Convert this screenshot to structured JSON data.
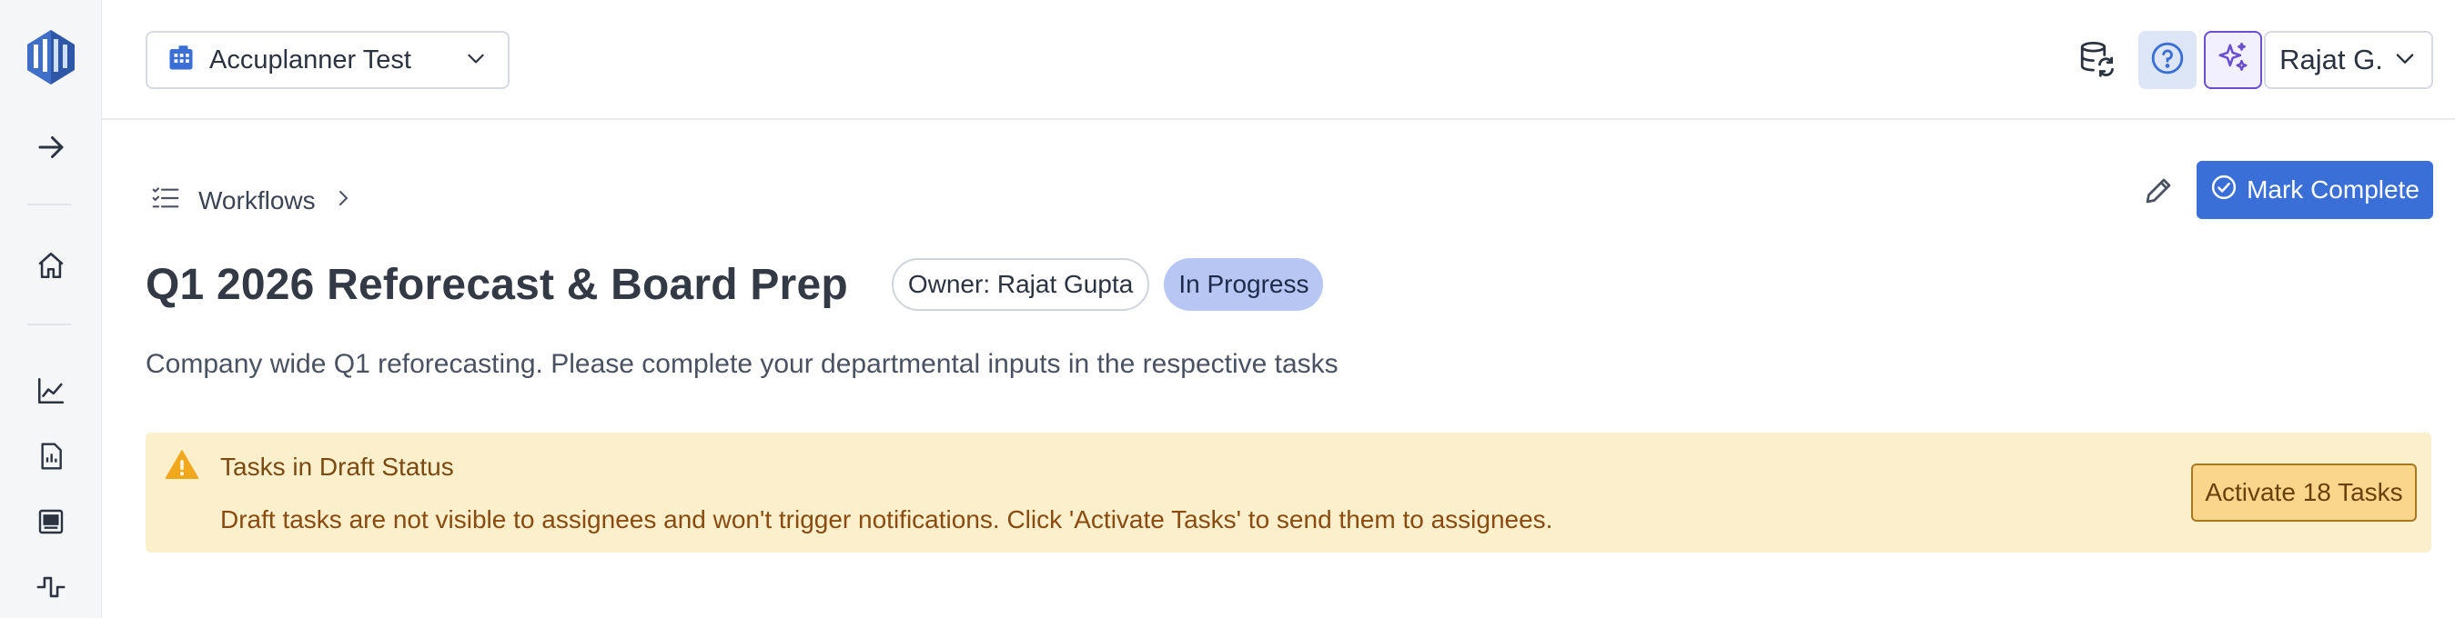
{
  "topbar": {
    "company_label": "Accuplanner Test",
    "user_label": "Rajat G."
  },
  "breadcrumb": {
    "workflows_label": "Workflows"
  },
  "workflow": {
    "title": "Q1 2026 Reforecast & Board Prep",
    "owner": "Owner: Rajat Gupta",
    "status": "In Progress",
    "description": "Company wide Q1 reforecasting. Please complete your departmental inputs in the respective tasks",
    "mark_complete_label": "Mark Complete"
  },
  "alert": {
    "title": "Tasks in Draft Status",
    "message": "Draft tasks are not visible to assignees and won't trigger notifications. Click 'Activate Tasks' to send them to assignees.",
    "action_label": "Activate 18 Tasks"
  },
  "colors": {
    "primary": "#3a6fd8",
    "status_badge_bg": "#b7c6f3",
    "alert_bg": "#fcefcb",
    "alert_button_bg": "#fad68c",
    "sidebar_bg": "#f5f6f8"
  },
  "icons": {
    "sidebar": [
      "logo-icon",
      "expand-arrow-icon",
      "home-icon",
      "line-chart-icon",
      "report-icon",
      "image-board-icon",
      "pulse-icon"
    ],
    "topbar": [
      "building-icon",
      "chevron-down-icon",
      "database-sync-icon",
      "help-icon",
      "sparkle-icon"
    ]
  }
}
